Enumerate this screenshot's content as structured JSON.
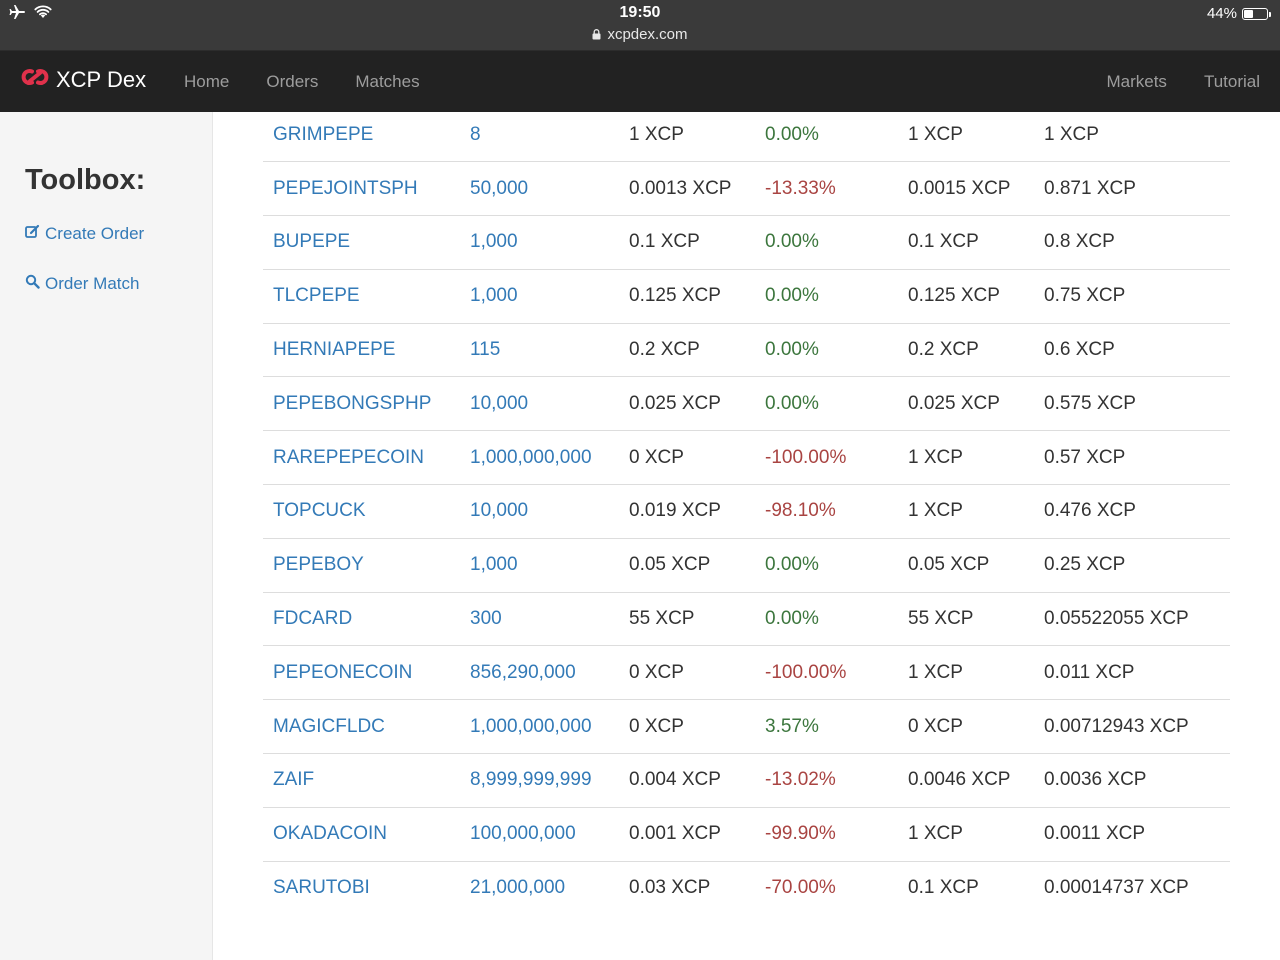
{
  "status_bar": {
    "time": "19:50",
    "url": "xcpdex.com",
    "battery": "44%",
    "battery_level": 0.44,
    "icons": [
      "airplane-icon",
      "wifi-icon",
      "lock-icon",
      "battery-icon"
    ]
  },
  "navbar": {
    "brand": "XCP Dex",
    "left_links": [
      "Home",
      "Orders",
      "Matches"
    ],
    "right_links": [
      "Markets",
      "Tutorial"
    ],
    "colors": {
      "background": "#222222",
      "link": "#9d9d9d",
      "logo": "#e0314b"
    }
  },
  "sidebar": {
    "title": "Toolbox:",
    "items": [
      {
        "label": "Create Order",
        "icon": "edit-icon"
      },
      {
        "label": "Order Match",
        "icon": "search-icon"
      }
    ]
  },
  "table": {
    "rows": [
      {
        "asset": "GRIMPEPE",
        "supply": "8",
        "price": "1 XCP",
        "change": "0.00%",
        "change_dir": "pos",
        "bid": "1 XCP",
        "value": "1 XCP"
      },
      {
        "asset": "PEPEJOINTSPH",
        "supply": "50,000",
        "price": "0.0013 XCP",
        "change": "-13.33%",
        "change_dir": "neg",
        "bid": "0.0015 XCP",
        "value": "0.871 XCP"
      },
      {
        "asset": "BUPEPE",
        "supply": "1,000",
        "price": "0.1 XCP",
        "change": "0.00%",
        "change_dir": "pos",
        "bid": "0.1 XCP",
        "value": "0.8 XCP"
      },
      {
        "asset": "TLCPEPE",
        "supply": "1,000",
        "price": "0.125 XCP",
        "change": "0.00%",
        "change_dir": "pos",
        "bid": "0.125 XCP",
        "value": "0.75 XCP"
      },
      {
        "asset": "HERNIAPEPE",
        "supply": "115",
        "price": "0.2 XCP",
        "change": "0.00%",
        "change_dir": "pos",
        "bid": "0.2 XCP",
        "value": "0.6 XCP"
      },
      {
        "asset": "PEPEBONGSPHP",
        "supply": "10,000",
        "price": "0.025 XCP",
        "change": "0.00%",
        "change_dir": "pos",
        "bid": "0.025 XCP",
        "value": "0.575 XCP"
      },
      {
        "asset": "RAREPEPECOIN",
        "supply": "1,000,000,000",
        "price": "0 XCP",
        "change": "-100.00%",
        "change_dir": "neg",
        "bid": "1 XCP",
        "value": "0.57 XCP"
      },
      {
        "asset": "TOPCUCK",
        "supply": "10,000",
        "price": "0.019 XCP",
        "change": "-98.10%",
        "change_dir": "neg",
        "bid": "1 XCP",
        "value": "0.476 XCP"
      },
      {
        "asset": "PEPEBOY",
        "supply": "1,000",
        "price": "0.05 XCP",
        "change": "0.00%",
        "change_dir": "pos",
        "bid": "0.05 XCP",
        "value": "0.25 XCP"
      },
      {
        "asset": "FDCARD",
        "supply": "300",
        "price": "55 XCP",
        "change": "0.00%",
        "change_dir": "pos",
        "bid": "55 XCP",
        "value": "0.05522055 XCP"
      },
      {
        "asset": "PEPEONECOIN",
        "supply": "856,290,000",
        "price": "0 XCP",
        "change": "-100.00%",
        "change_dir": "neg",
        "bid": "1 XCP",
        "value": "0.011 XCP"
      },
      {
        "asset": "MAGICFLDC",
        "supply": "1,000,000,000",
        "price": "0 XCP",
        "change": "3.57%",
        "change_dir": "pos",
        "bid": "0 XCP",
        "value": "0.00712943 XCP"
      },
      {
        "asset": "ZAIF",
        "supply": "8,999,999,999",
        "price": "0.004 XCP",
        "change": "-13.02%",
        "change_dir": "neg",
        "bid": "0.0046 XCP",
        "value": "0.0036 XCP"
      },
      {
        "asset": "OKADACOIN",
        "supply": "100,000,000",
        "price": "0.001 XCP",
        "change": "-99.90%",
        "change_dir": "neg",
        "bid": "1 XCP",
        "value": "0.0011 XCP"
      },
      {
        "asset": "SARUTOBI",
        "supply": "21,000,000",
        "price": "0.03 XCP",
        "change": "-70.00%",
        "change_dir": "neg",
        "bid": "0.1 XCP",
        "value": "0.00014737 XCP"
      }
    ],
    "colors": {
      "link": "#337ab7",
      "positive": "#3c763d",
      "negative": "#a94442",
      "text": "#333333"
    }
  }
}
